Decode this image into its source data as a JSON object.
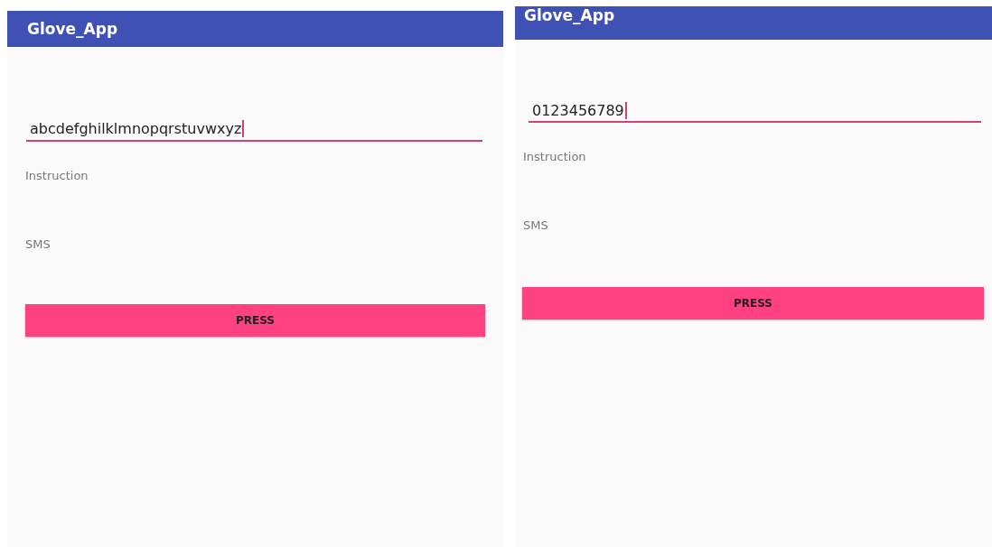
{
  "screens": [
    {
      "title": "Glove_App",
      "field": {
        "value": "abcdefghilklmnopqrstuvwxyz",
        "focused": true
      },
      "labels": [
        "Instruction",
        "SMS"
      ],
      "button": "PRESS"
    },
    {
      "title": "Glove_App",
      "field": {
        "value": "0123456789",
        "focused": true
      },
      "labels": [
        "Instruction",
        "SMS"
      ],
      "button": "PRESS"
    }
  ]
}
